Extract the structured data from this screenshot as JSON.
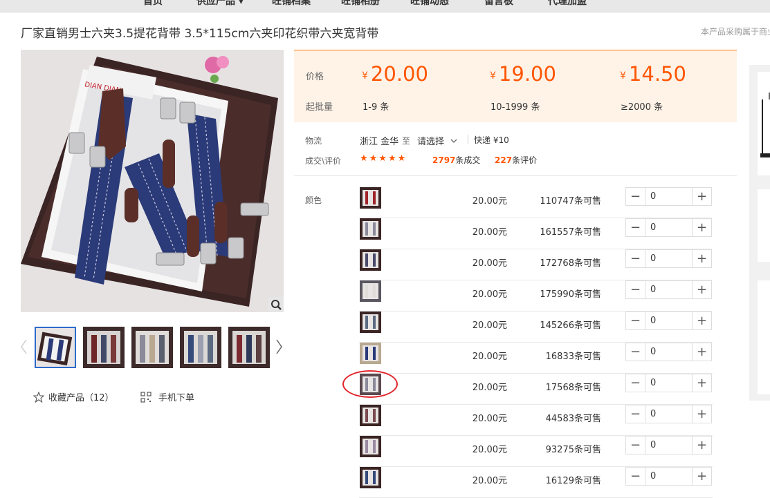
{
  "nav": {
    "items": [
      "首页",
      "供应产品 ▾",
      "旺铺档案",
      "旺铺相册",
      "旺铺动态",
      "留言板",
      "代理加盟"
    ]
  },
  "product": {
    "title": "厂家直销男士六夹3.5提花背带 3.5*115cm六夹印花织带六夹宽背带",
    "notice": "本产品采购属于商业",
    "image_brand": "DIAN DIAN"
  },
  "icons": {
    "zoom": "magnifier-icon",
    "star": "star-outline-icon",
    "qr": "qr-code-icon",
    "prev": "chevron-left-icon",
    "next": "chevron-right-icon",
    "dropdown": "chevron-down-icon"
  },
  "favorite": {
    "label": "收藏产品（12）"
  },
  "mobile_order": {
    "label": "手机下单"
  },
  "price": {
    "price_label": "价格",
    "qty_label": "起批量",
    "currency": "¥",
    "tiers": [
      {
        "price": "20.00",
        "qty": "1-9 条"
      },
      {
        "price": "19.00",
        "qty": "10-1999 条"
      },
      {
        "price": "14.50",
        "qty": "≥2000 条"
      }
    ]
  },
  "logistics": {
    "label": "物流",
    "origin": "浙江 金华",
    "to": "至",
    "dest": "请选择",
    "express": "快递 ¥10"
  },
  "reviews": {
    "label": "成交\\评价",
    "stars": "★★★★★",
    "sold_count": "2797",
    "sold_suffix": "条成交",
    "review_count": "227",
    "review_suffix": "条评价"
  },
  "sku": {
    "color_label": "颜色",
    "price_suffix": "元",
    "stock_suffix": "条可售",
    "rows": [
      {
        "price": "20.00",
        "stock": "110747",
        "qty": "0"
      },
      {
        "price": "20.00",
        "stock": "161557",
        "qty": "0"
      },
      {
        "price": "20.00",
        "stock": "172768",
        "qty": "0"
      },
      {
        "price": "20.00",
        "stock": "175990",
        "qty": "0"
      },
      {
        "price": "20.00",
        "stock": "145266",
        "qty": "0"
      },
      {
        "price": "20.00",
        "stock": "16833",
        "qty": "0"
      },
      {
        "price": "20.00",
        "stock": "17568",
        "qty": "0"
      },
      {
        "price": "20.00",
        "stock": "44583",
        "qty": "0"
      },
      {
        "price": "20.00",
        "stock": "93275",
        "qty": "0"
      },
      {
        "price": "20.00",
        "stock": "16129",
        "qty": "0"
      }
    ],
    "minus": "−",
    "plus": "+"
  },
  "colors": {
    "accent": "#ff5500",
    "price_bg": "#fff3e8",
    "highlight_circle": "#e3242b",
    "thumb_active": "#2d6acb"
  }
}
